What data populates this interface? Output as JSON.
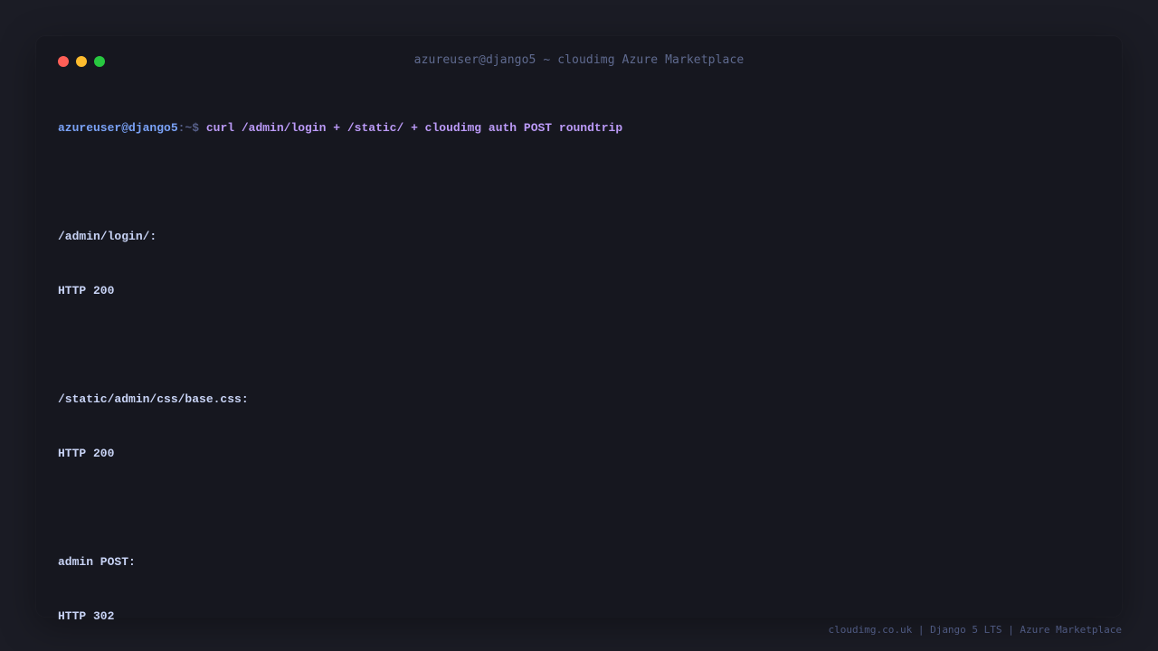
{
  "window": {
    "title": "azureuser@django5 ~ cloudimg Azure Marketplace",
    "controls": [
      {
        "name": "close",
        "color": "#ff5f57"
      },
      {
        "name": "minimize",
        "color": "#febc2e"
      },
      {
        "name": "zoom",
        "color": "#28c840"
      }
    ]
  },
  "terminal": {
    "prompt_user": "azureuser@django5",
    "prompt_path": ":~$ ",
    "command": "curl /admin/login + /static/ + cloudimg auth POST roundtrip",
    "results": [
      {
        "label": "/admin/login/:",
        "value": "HTTP 200"
      },
      {
        "label": "/static/admin/css/base.css:",
        "value": "HTTP 200"
      },
      {
        "label": "admin POST:",
        "value": "HTTP 302"
      }
    ]
  },
  "footer": {
    "text": "cloudimg.co.uk | Django 5 LTS | Azure Marketplace"
  },
  "colors": {
    "background": "#1b1c25",
    "window": "#16171f",
    "prompt_user": "#7aa2f7",
    "command": "#bb9af7",
    "output": "#c8d3f5"
  }
}
